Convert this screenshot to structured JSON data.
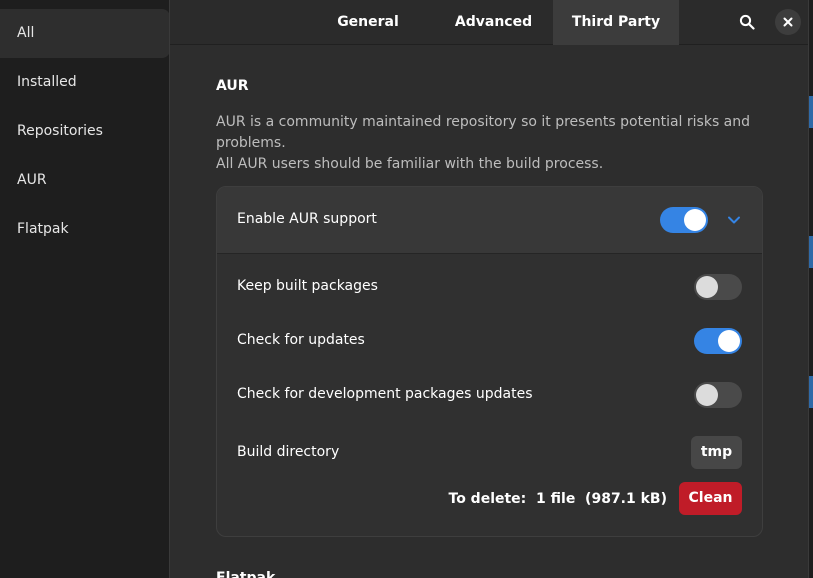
{
  "sidebar": {
    "items": [
      {
        "label": "All",
        "selected": true
      },
      {
        "label": "Installed"
      },
      {
        "label": "Repositories"
      },
      {
        "label": "AUR"
      },
      {
        "label": "Flatpak"
      }
    ]
  },
  "header": {
    "tabs": [
      {
        "label": "General"
      },
      {
        "label": "Advanced"
      },
      {
        "label": "Third Party",
        "active": true
      }
    ],
    "search_icon": "search-icon",
    "close_icon": "close-icon"
  },
  "aur": {
    "title": "AUR",
    "description_line1": "AUR is a community maintained repository so it presents potential risks and problems.",
    "description_line2": "All AUR users should be familiar with the build process.",
    "enable_label": "Enable AUR support",
    "enable_on": true,
    "keep_built_label": "Keep built packages",
    "keep_built_on": false,
    "check_updates_label": "Check for updates",
    "check_updates_on": true,
    "check_dev_label": "Check for development packages updates",
    "check_dev_on": false,
    "build_dir_label": "Build directory",
    "build_dir_value": "tmp",
    "to_delete_text": "To delete:  1 file  (987.1 kB)",
    "clean_label": "Clean"
  },
  "colors": {
    "accent": "#3584e4",
    "destructive": "#c01c28"
  }
}
